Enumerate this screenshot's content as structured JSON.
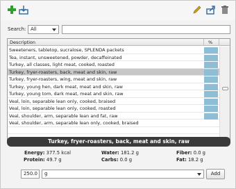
{
  "toolbar": {
    "icons": [
      "plus-icon",
      "import-icon",
      "pencil-icon",
      "export-icon",
      "trash-icon"
    ],
    "colors": {
      "plus": "#2e9e2e",
      "import": "#3a6ea5",
      "pencil": "#d2a018",
      "export": "#3a6ea5",
      "trash": "#7a7a7a"
    }
  },
  "search": {
    "label": "Search:",
    "scope_value": "All",
    "query_value": ""
  },
  "table": {
    "headers": {
      "description": "Description",
      "percent": "%"
    },
    "rows": [
      {
        "description": "Sweeteners, tabletop, sucralose, SPLENDA packets",
        "bar": true
      },
      {
        "description": "Tea, instant, unsweetened, powder, decaffeinated",
        "bar": true
      },
      {
        "description": "Turkey, all classes, light meat, cooked, roasted",
        "bar": true
      },
      {
        "description": "Turkey, fryer-roasters, back, meat and skin, raw",
        "bar": true,
        "selected": true
      },
      {
        "description": "Turkey, fryer-roasters, wing, meat and skin, raw",
        "bar": true
      },
      {
        "description": "Turkey, young hen, dark meat, meat and skin, raw",
        "bar": true
      },
      {
        "description": "Turkey, young tom, dark meat, meat and skin, raw",
        "bar": true
      },
      {
        "description": "Veal, loin, separable lean only, cooked, braised",
        "bar": true
      },
      {
        "description": "Veal, loin, separable lean only, cooked, roasted",
        "bar": true
      },
      {
        "description": "Veal, shoulder, arm, separable lean and fat, raw",
        "bar": true
      },
      {
        "description": "Veal, shoulder, arm, separable lean only, cooked, braised",
        "bar": false
      },
      {
        "description": "",
        "bar": false
      },
      {
        "description": "",
        "bar": false
      }
    ],
    "highlight_color": "#8dbed6",
    "selected_color": "#c7c7c7"
  },
  "detail": {
    "title": "Turkey, fryer-roasters, back, meat and skin, raw",
    "nutrients": {
      "energy": {
        "label": "Energy:",
        "value": "377.5 kcal"
      },
      "water": {
        "label": "Water:",
        "value": "181.2 g"
      },
      "fiber": {
        "label": "Fiber:",
        "value": "0.0 g"
      },
      "protein": {
        "label": "Protein:",
        "value": "49.7 g"
      },
      "carbs": {
        "label": "Carbs:",
        "value": "0.0 g"
      },
      "fat": {
        "label": "Fat:",
        "value": "18.2 g"
      }
    }
  },
  "amount": {
    "quantity": "250.0",
    "unit": "g",
    "add_label": "Add"
  }
}
